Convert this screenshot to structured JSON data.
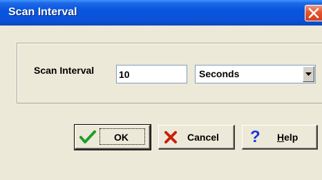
{
  "window": {
    "title": "Scan Interval"
  },
  "form": {
    "label": "Scan Interval",
    "interval_value": "10",
    "unit_selected": "Seconds"
  },
  "buttons": {
    "ok": {
      "label": "OK",
      "icon": "checkmark-icon"
    },
    "cancel": {
      "label": "Cancel",
      "icon": "x-icon"
    },
    "help": {
      "label_mnemonic": "H",
      "label_rest": "elp",
      "icon": "question-icon",
      "icon_glyph": "?"
    }
  },
  "colors": {
    "titlebar": "#0855dd",
    "close": "#e3542f",
    "face": "#ece9d8",
    "check": "#1f9e26",
    "cancel_x": "#cc1e0c",
    "help_q": "#1a38d8"
  }
}
